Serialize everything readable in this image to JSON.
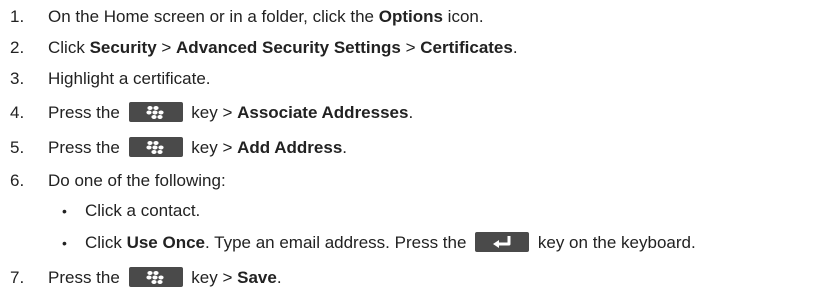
{
  "steps": [
    {
      "num": "1.",
      "parts": [
        "On the Home screen or in a folder, click the ",
        "Options",
        " icon."
      ]
    },
    {
      "num": "2.",
      "parts": [
        "Click ",
        "Security",
        " > ",
        "Advanced Security Settings",
        " > ",
        "Certificates",
        "."
      ]
    },
    {
      "num": "3.",
      "parts": [
        "Highlight a certificate."
      ]
    },
    {
      "num": "4.",
      "parts": [
        "Press the ",
        " key > ",
        "Associate Addresses",
        "."
      ]
    },
    {
      "num": "5.",
      "parts": [
        "Press the ",
        " key > ",
        "Add Address",
        "."
      ]
    },
    {
      "num": "6.",
      "parts": [
        "Do one of the following:"
      ]
    },
    {
      "num": "7.",
      "parts": [
        "Press the ",
        " key > ",
        "Save",
        "."
      ]
    }
  ],
  "substeps": [
    {
      "bullet": "•",
      "parts": [
        "Click a contact."
      ]
    },
    {
      "bullet": "•",
      "parts": [
        "Click ",
        "Use Once",
        ". Type an email address. Press the ",
        " key on the keyboard."
      ]
    }
  ],
  "icons": {
    "menu_key": "blackberry-menu-key-icon",
    "enter_key": "enter-key-icon"
  },
  "colors": {
    "text": "#222222",
    "key_background": "#4a4a4a"
  }
}
